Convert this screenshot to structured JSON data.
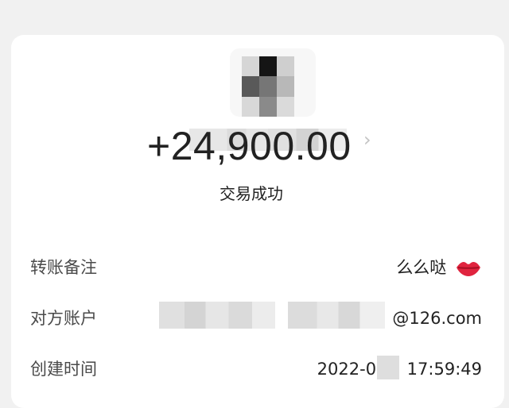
{
  "transfer": {
    "amount": "+24,900.00",
    "status": "交易成功",
    "chevron": "›"
  },
  "details": {
    "remark_label": "转账备注",
    "remark_value": "么么哒",
    "remark_icon": "lips-icon",
    "account_label": "对方账户",
    "account_value_visible": "@126.com",
    "time_label": "创建时间",
    "time_prefix": "2022-06-",
    "time_suffix": "17:59:49"
  },
  "colors": {
    "background": "#f1f1f1",
    "card": "#ffffff",
    "text": "#1f1f1f",
    "label": "#4a4a4a",
    "lips": "#e0243f"
  }
}
